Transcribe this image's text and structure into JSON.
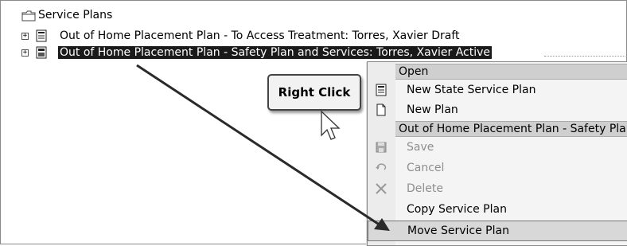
{
  "tree": {
    "root_label": "Service Plans",
    "nodes": [
      {
        "label": "Out of Home Placement Plan - To Access Treatment:  Torres, Xavier Draft",
        "expander": "+",
        "selected": false
      },
      {
        "label": "Out of Home Placement Plan - Safety Plan and Services:  Torres, Xavier Active",
        "expander": "+",
        "selected": true
      }
    ]
  },
  "callout": {
    "text": "Right Click"
  },
  "context_menu": {
    "section_open": "Open",
    "items_open": [
      {
        "label": "New State Service Plan",
        "icon": "document-lines-icon",
        "enabled": true
      },
      {
        "label": "New Plan",
        "icon": "blank-document-icon",
        "enabled": true
      }
    ],
    "section_plan": "Out of Home Placement Plan - Safety Plan and Services",
    "items_plan": [
      {
        "label": "Save",
        "icon": "save-icon",
        "enabled": false
      },
      {
        "label": "Cancel",
        "icon": "undo-icon",
        "enabled": false
      },
      {
        "label": "Delete",
        "icon": "delete-x-icon",
        "enabled": false
      },
      {
        "label": "Copy Service Plan",
        "icon": "",
        "enabled": true
      },
      {
        "label": "Move Service Plan",
        "icon": "",
        "enabled": true,
        "highlighted": true
      }
    ]
  },
  "colors": {
    "selection_bg": "#1a1a1a",
    "menu_bg": "#f4f4f4",
    "menu_header_bg": "#cfcfcf",
    "disabled_text": "#8e8e8e"
  }
}
